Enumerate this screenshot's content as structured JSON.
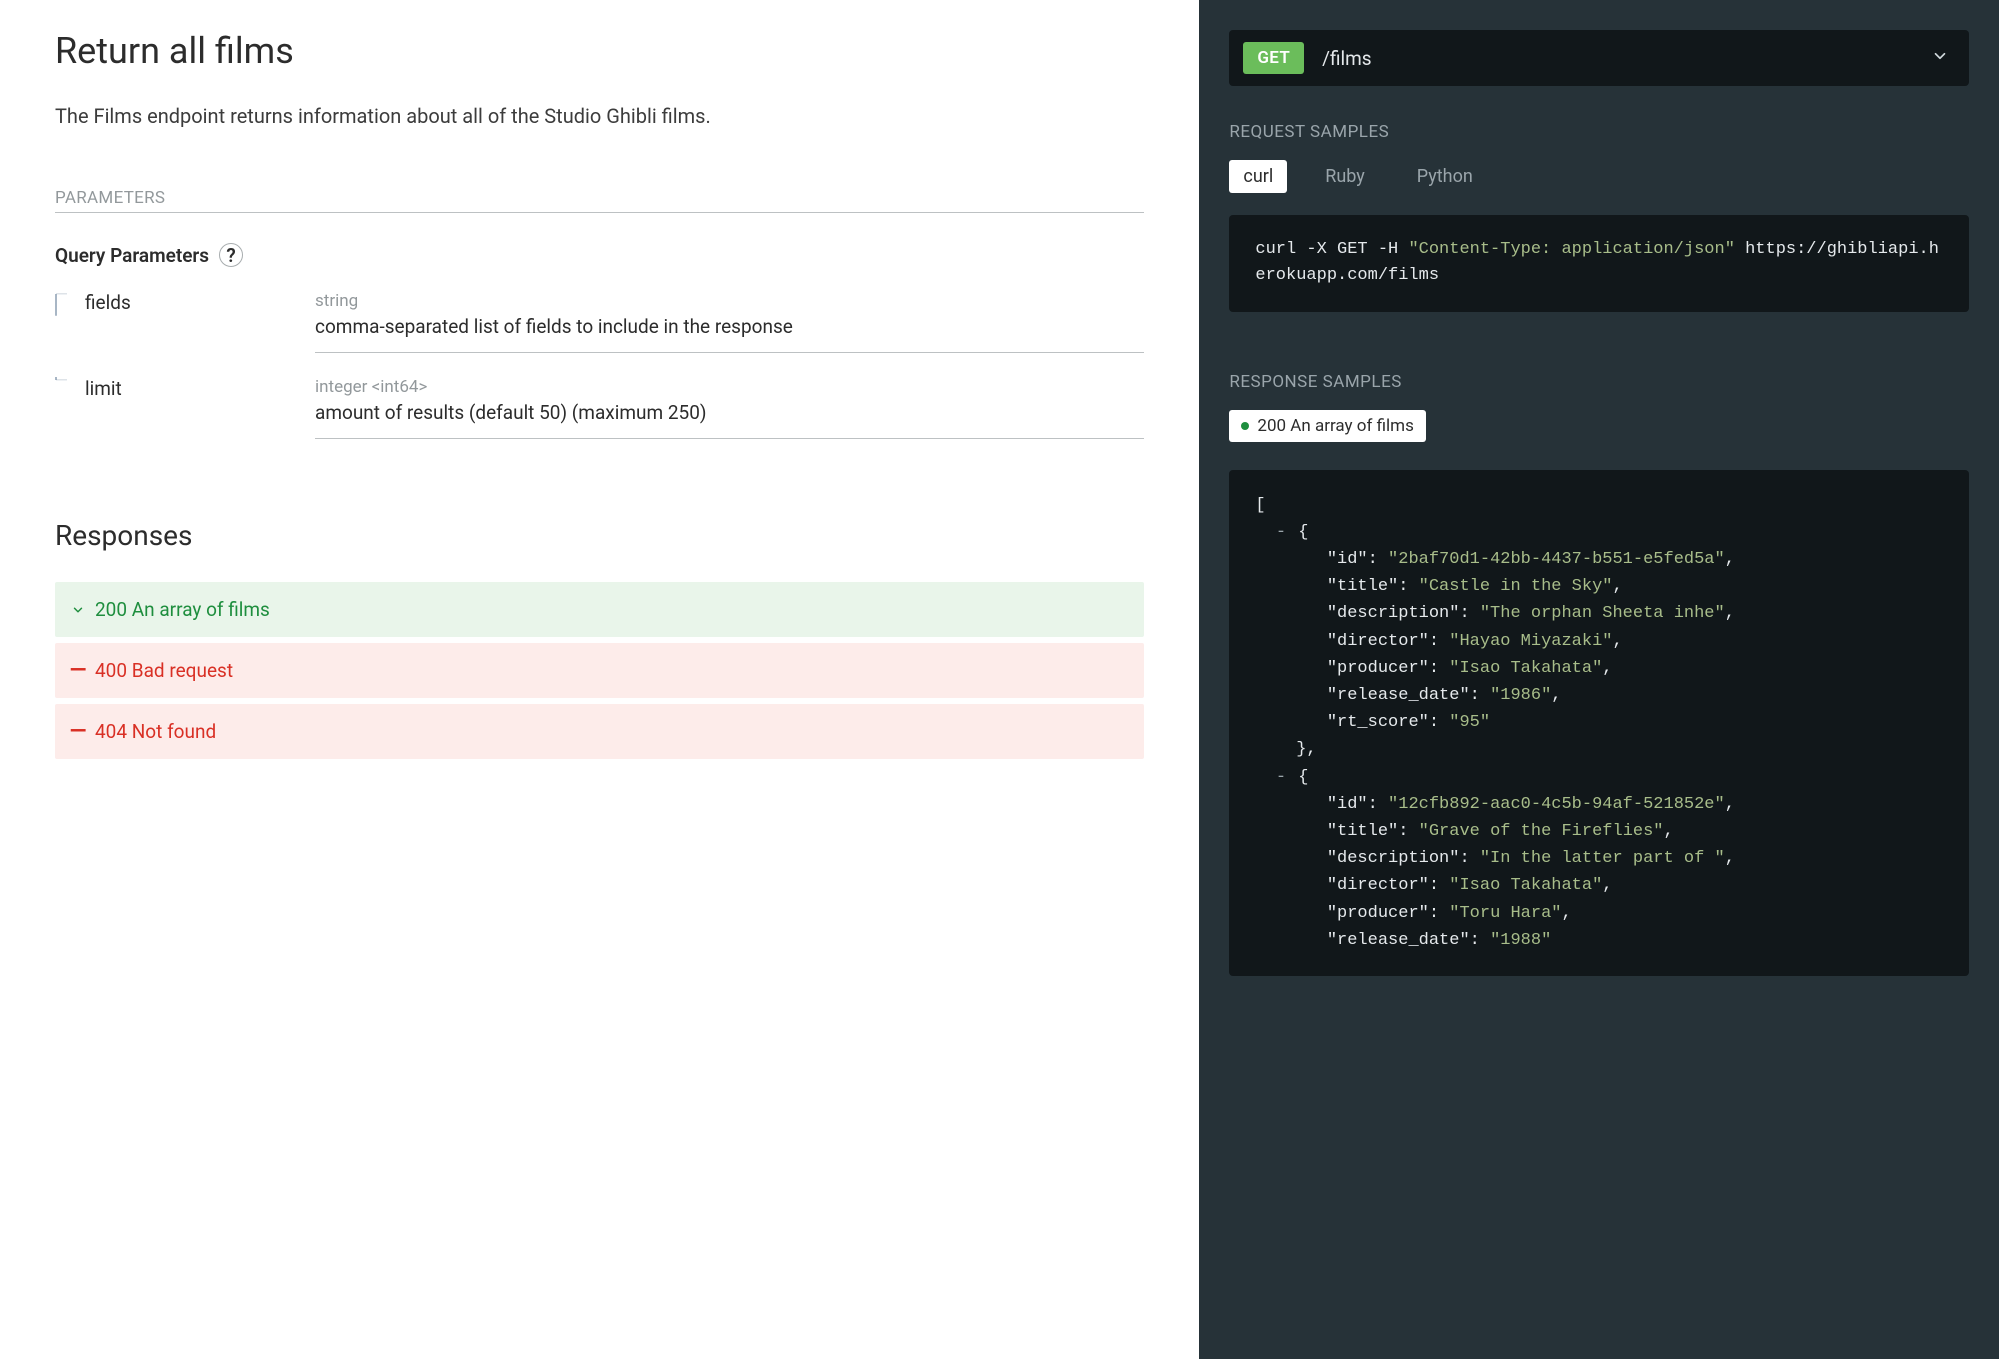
{
  "page": {
    "title": "Return all films",
    "description": "The Films endpoint returns information about all of the Studio Ghibli films.",
    "parameters_label": "PARAMETERS",
    "query_params_heading": "Query Parameters",
    "responses_heading": "Responses"
  },
  "params": [
    {
      "name": "fields",
      "type": "string",
      "desc": "comma-separated list of fields to include in the response"
    },
    {
      "name": "limit",
      "type": "integer <int64>",
      "desc": "amount of results (default 50) (maximum 250)"
    }
  ],
  "responses": [
    {
      "status": "200",
      "text": "An array of films",
      "kind": "success",
      "open": true
    },
    {
      "status": "400",
      "text": "Bad request",
      "kind": "error",
      "open": false
    },
    {
      "status": "404",
      "text": "Not found",
      "kind": "error",
      "open": false
    }
  ],
  "right": {
    "method": "GET",
    "path": "/films",
    "request_samples_label": "REQUEST SAMPLES",
    "response_samples_label": "RESPONSE SAMPLES",
    "tabs": [
      "curl",
      "Ruby",
      "Python"
    ],
    "active_tab": "curl",
    "curl_parts": {
      "prefix": "curl -X GET -H ",
      "header_str": "\"Content-Type: application/json\"",
      "url": " https://ghibliapi.herokuapp.com/films"
    },
    "response_chip": "200 An array of films",
    "response_json": [
      {
        "id": "2baf70d1-42bb-4437-b551-e5fed5a",
        "title": "Castle in the Sky",
        "description": "The orphan Sheeta inhe",
        "director": "Hayao Miyazaki",
        "producer": "Isao Takahata",
        "release_date": "1986",
        "rt_score": "95"
      },
      {
        "id": "12cfb892-aac0-4c5b-94af-521852e",
        "title": "Grave of the Fireflies",
        "description": "In the latter part of ",
        "director": "Isao Takahata",
        "producer": "Toru Hara",
        "release_date": "1988"
      }
    ]
  }
}
